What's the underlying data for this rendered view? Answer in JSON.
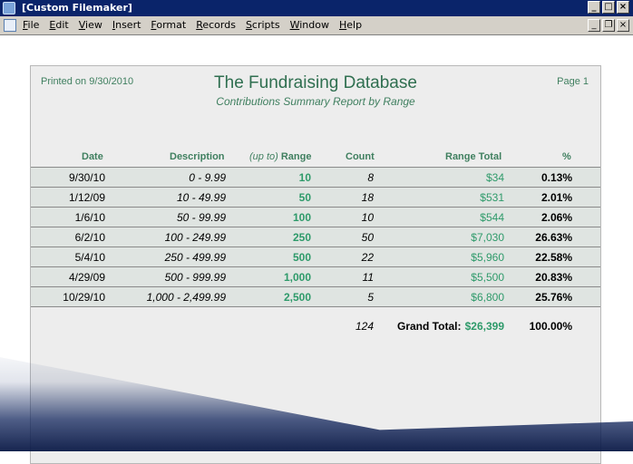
{
  "window": {
    "title": "[Custom Filemaker]"
  },
  "menu": [
    "File",
    "Edit",
    "View",
    "Insert",
    "Format",
    "Records",
    "Scripts",
    "Window",
    "Help"
  ],
  "report": {
    "printed": "Printed on 9/30/2010",
    "page": "Page 1",
    "title": "The Fundraising Database",
    "subtitle": "Contributions Summary Report by Range",
    "headers": {
      "date": "Date",
      "description": "Description",
      "range_prefix": "(up to)",
      "range": "Range",
      "count": "Count",
      "range_total": "Range Total",
      "pct": "%"
    },
    "rows": [
      {
        "date": "9/30/10",
        "description": "0 - 9.99",
        "range": "10",
        "count": "8",
        "total": "$34",
        "pct": "0.13%"
      },
      {
        "date": "1/12/09",
        "description": "10 - 49.99",
        "range": "50",
        "count": "18",
        "total": "$531",
        "pct": "2.01%"
      },
      {
        "date": "1/6/10",
        "description": "50 - 99.99",
        "range": "100",
        "count": "10",
        "total": "$544",
        "pct": "2.06%"
      },
      {
        "date": "6/2/10",
        "description": "100 - 249.99",
        "range": "250",
        "count": "50",
        "total": "$7,030",
        "pct": "26.63%"
      },
      {
        "date": "5/4/10",
        "description": "250 - 499.99",
        "range": "500",
        "count": "22",
        "total": "$5,960",
        "pct": "22.58%"
      },
      {
        "date": "4/29/09",
        "description": "500 - 999.99",
        "range": "1,000",
        "count": "11",
        "total": "$5,500",
        "pct": "20.83%"
      },
      {
        "date": "10/29/10",
        "description": "1,000 - 2,499.99",
        "range": "2,500",
        "count": "5",
        "total": "$6,800",
        "pct": "25.76%"
      }
    ],
    "totals": {
      "count": "124",
      "grand_label": "Grand Total:",
      "grand_total": "$26,399",
      "pct": "100.00%"
    }
  }
}
